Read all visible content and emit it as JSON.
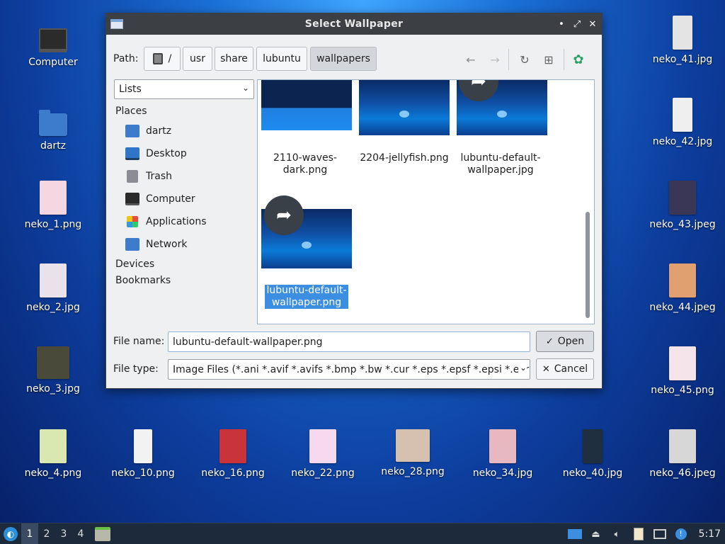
{
  "desktop": {
    "icons": [
      {
        "label": "Computer"
      },
      {
        "label": "dartz"
      },
      {
        "label": "neko_1.png"
      },
      {
        "label": "neko_2.jpg"
      },
      {
        "label": "neko_3.jpg"
      },
      {
        "label": "neko_4.png"
      },
      {
        "label": "neko_10.png"
      },
      {
        "label": "neko_16.png"
      },
      {
        "label": "neko_22.png"
      },
      {
        "label": "neko_28.png"
      },
      {
        "label": "neko_34.jpg"
      },
      {
        "label": "neko_40.jpg"
      },
      {
        "label": "neko_41.jpg"
      },
      {
        "label": "neko_42.jpg"
      },
      {
        "label": "neko_43.jpeg"
      },
      {
        "label": "neko_44.jpeg"
      },
      {
        "label": "neko_45.png"
      },
      {
        "label": "neko_46.jpeg"
      }
    ],
    "thumb_colors": [
      "#f4d7e0",
      "#e9e2ea",
      "#4a4a3a",
      "#d8e8b0",
      "#f2f2f2",
      "#c9343a",
      "#f6d9ee",
      "#d6c1b0",
      "#e8b8c0",
      "#1f2f3f",
      "#e4e4e4",
      "#efefef",
      "#3a3656",
      "#e0a070",
      "#f5e4ea",
      "#d7d7d7"
    ]
  },
  "dialog": {
    "title": "Select Wallpaper",
    "path_label": "Path:",
    "breadcrumbs": [
      {
        "label": "/"
      },
      {
        "label": "usr"
      },
      {
        "label": "share"
      },
      {
        "label": "lubuntu"
      },
      {
        "label": "wallpapers"
      }
    ],
    "view_mode": "Lists",
    "places_heading": "Places",
    "places": [
      {
        "label": "dartz"
      },
      {
        "label": "Desktop"
      },
      {
        "label": "Trash"
      },
      {
        "label": "Computer"
      },
      {
        "label": "Applications"
      },
      {
        "label": "Network"
      }
    ],
    "devices_heading": "Devices",
    "bookmarks_heading": "Bookmarks",
    "files": [
      {
        "name_line1": "2110-waves-",
        "name_line2": "dark.png"
      },
      {
        "name_line1": "2204-jellyfish.png",
        "name_line2": ""
      },
      {
        "name_line1": "lubuntu-default-",
        "name_line2": "wallpaper.jpg"
      },
      {
        "name_line1": "lubuntu-default-",
        "name_line2": "wallpaper.png"
      }
    ],
    "filename_label": "File name:",
    "filename_value": "lubuntu-default-wallpaper.png",
    "filetype_label": "File type:",
    "filetype_value": "Image Files (*.ani *.avif *.avifs *.bmp *.bw *.cur *.eps *.epsf *.epsi *.exr *",
    "open_label": "Open",
    "cancel_label": "Cancel"
  },
  "taskbar": {
    "desktops": [
      "1",
      "2",
      "3",
      "4"
    ],
    "clock": "5:17"
  }
}
